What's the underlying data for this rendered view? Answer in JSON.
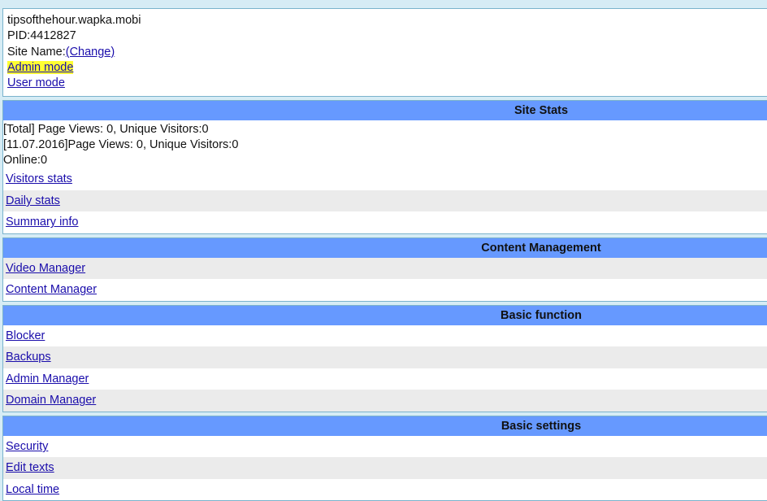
{
  "site": {
    "domain": "tipsofthehour.wapka.mobi",
    "pid": "PID:4412827",
    "site_name_label": "Site Name:",
    "change_link": "(Change)",
    "admin_mode": "Admin mode",
    "user_mode": "User mode"
  },
  "site_stats": {
    "title": "Site Stats",
    "total_line": "[Total] Page Views: 0, Unique Visitors:0",
    "daily_line": "[11.07.2016]Page Views: 0, Unique Visitors:0",
    "online_line": "Online:0",
    "links": [
      "Visitors stats",
      "Daily stats",
      "Summary info"
    ]
  },
  "content_management": {
    "title": "Content Management",
    "links": [
      "Video Manager",
      "Content Manager"
    ]
  },
  "basic_function": {
    "title": "Basic function",
    "links": [
      "Blocker",
      "Backups",
      "Admin Manager",
      "Domain Manager"
    ]
  },
  "basic_settings": {
    "title": "Basic settings",
    "links": [
      "Security",
      "Edit texts",
      "Local time"
    ]
  },
  "colors": {
    "header_bg": "#6699ff",
    "page_bg": "#d6ecf5",
    "highlight": "#ffff33",
    "link": "#1a0dab",
    "alt_row": "#ebebeb"
  }
}
